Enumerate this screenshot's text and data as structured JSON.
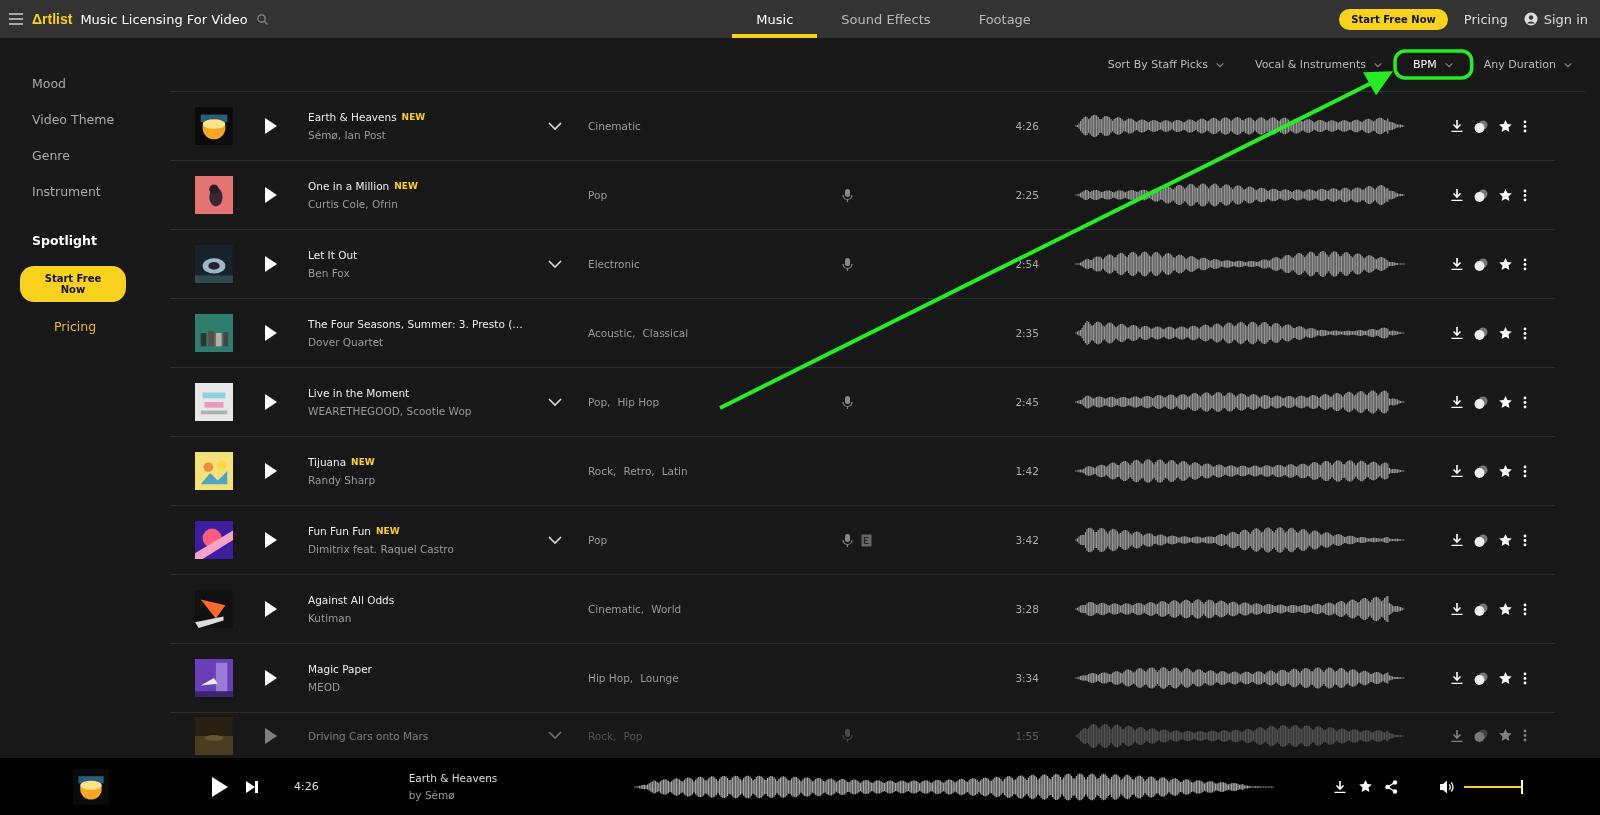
{
  "header": {
    "logo": "Δrtlist",
    "title": "Music Licensing For Video",
    "tabs": [
      {
        "label": "Music",
        "selected": true
      },
      {
        "label": "Sound Effects",
        "selected": false
      },
      {
        "label": "Footage",
        "selected": false
      }
    ],
    "cta": "Start Free Now",
    "pricing": "Pricing",
    "sign_in": "Sign in"
  },
  "filters": [
    {
      "label": "Sort By Staff Picks",
      "highlighted": false
    },
    {
      "label": "Vocal & Instruments",
      "highlighted": false
    },
    {
      "label": "BPM",
      "highlighted": true
    },
    {
      "label": "Any Duration",
      "highlighted": false
    }
  ],
  "annotation": {
    "kind": "arrow",
    "color": "#22ee22"
  },
  "sidebar": {
    "items": [
      "Mood",
      "Video Theme",
      "Genre",
      "Instrument"
    ],
    "spotlight": "Spotlight",
    "cta": "Start Free Now",
    "pricing": "Pricing"
  },
  "tracks": [
    {
      "title": "Earth & Heavens",
      "badge": "NEW",
      "artists": "Sémø, Ian Post",
      "expandable": true,
      "genres": [
        "Cinematic"
      ],
      "vocals": false,
      "extra": false,
      "duration": "4:26",
      "faded": false
    },
    {
      "title": "One in a Million",
      "badge": "NEW",
      "artists": "Curtis Cole, Ofrin",
      "expandable": false,
      "genres": [
        "Pop"
      ],
      "vocals": true,
      "extra": false,
      "duration": "2:25",
      "faded": false
    },
    {
      "title": "Let It Out",
      "artists": "Ben Fox",
      "expandable": true,
      "genres": [
        "Electronic"
      ],
      "vocals": true,
      "extra": false,
      "duration": "2:54",
      "faded": false
    },
    {
      "title": "The Four Seasons, Summer: 3. Presto (…",
      "artists": "Dover Quartet",
      "expandable": false,
      "genres": [
        "Acoustic,",
        "Classical"
      ],
      "vocals": false,
      "extra": false,
      "duration": "2:35",
      "faded": false
    },
    {
      "title": "Live in the Moment",
      "artists": "WEARETHEGOOD, Scootie Wop",
      "expandable": true,
      "genres": [
        "Pop,",
        "Hip Hop"
      ],
      "vocals": true,
      "extra": false,
      "duration": "2:45",
      "faded": false
    },
    {
      "title": "Tijuana",
      "badge": "NEW",
      "artists": "Randy Sharp",
      "expandable": false,
      "genres": [
        "Rock,",
        "Retro,",
        "Latin"
      ],
      "vocals": false,
      "extra": false,
      "duration": "1:42",
      "faded": false
    },
    {
      "title": "Fun Fun Fun",
      "badge": "NEW",
      "artists": "Dimitrix feat. Raquel Castro",
      "expandable": true,
      "genres": [
        "Pop"
      ],
      "vocals": true,
      "extra": true,
      "duration": "3:42",
      "faded": false
    },
    {
      "title": "Against All Odds",
      "artists": "Kutiman",
      "expandable": false,
      "genres": [
        "Cinematic,",
        "World"
      ],
      "vocals": false,
      "extra": false,
      "duration": "3:28",
      "faded": false
    },
    {
      "title": "Magic Paper",
      "artists": "MEOD",
      "expandable": false,
      "genres": [
        "Hip Hop,",
        "Lounge"
      ],
      "vocals": false,
      "extra": false,
      "duration": "3:34",
      "faded": false
    },
    {
      "title": "Driving Cars onto Mars",
      "expandable": true,
      "genres": [
        "Rock,",
        "Pop"
      ],
      "vocals": true,
      "extra": false,
      "duration": "1:55",
      "faded": true
    }
  ],
  "player": {
    "time": "4:26",
    "title": "Earth & Heavens",
    "artist": "by Sémø",
    "volume": {
      "level": 0.97
    }
  }
}
